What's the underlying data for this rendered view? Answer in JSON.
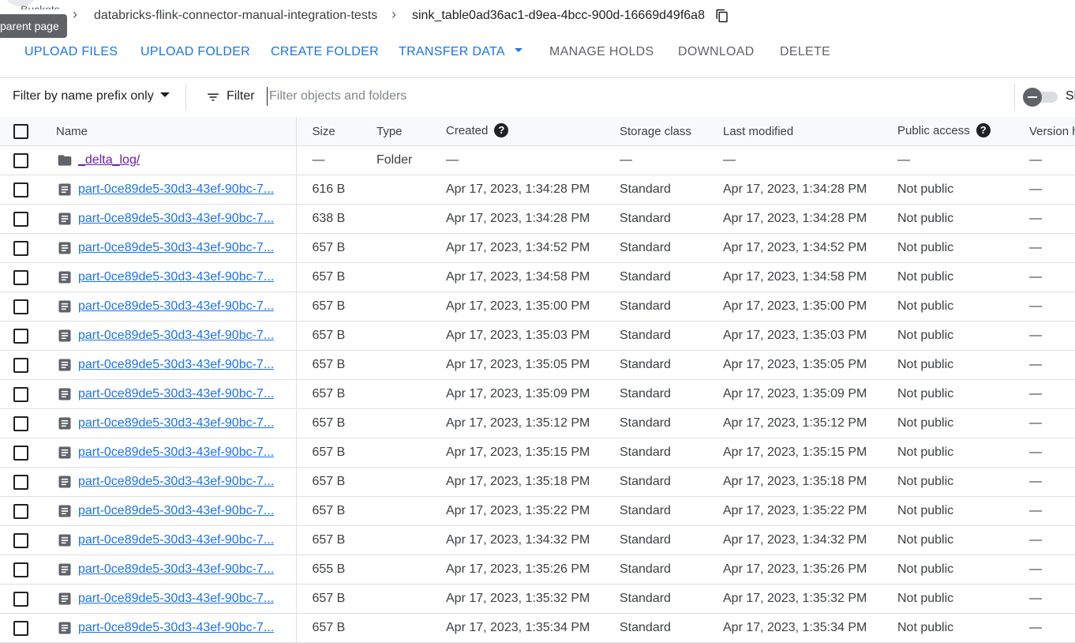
{
  "breadcrumb": {
    "root": "Buckets",
    "bucket": "databricks-flink-connector-manual-integration-tests",
    "folder": "sink_table0ad36ac1-d9ea-4bcc-900d-16669d49f6a8"
  },
  "tooltip": "parent page",
  "toolbar": {
    "upload_files": "UPLOAD FILES",
    "upload_folder": "UPLOAD FOLDER",
    "create_folder": "CREATE FOLDER",
    "transfer_data": "TRANSFER DATA",
    "manage_holds": "MANAGE HOLDS",
    "download": "DOWNLOAD",
    "delete": "DELETE"
  },
  "filter": {
    "prefix_mode": "Filter by name prefix only",
    "label": "Filter",
    "placeholder": "Filter objects and folders",
    "toggle_label": "Sh"
  },
  "columns": {
    "name": "Name",
    "size": "Size",
    "type": "Type",
    "created": "Created",
    "storage_class": "Storage class",
    "last_modified": "Last modified",
    "public_access": "Public access",
    "version_history": "Version h"
  },
  "rows": [
    {
      "kind": "folder",
      "name": "_delta_log/",
      "size": "—",
      "type": "Folder",
      "created": "—",
      "storage": "—",
      "modified": "—",
      "public": "—",
      "version": "—"
    },
    {
      "kind": "file",
      "name": "part-0ce89de5-30d3-43ef-90bc-7...",
      "size": "616 B",
      "type": "",
      "created": "Apr 17, 2023, 1:34:28 PM",
      "storage": "Standard",
      "modified": "Apr 17, 2023, 1:34:28 PM",
      "public": "Not public",
      "version": "—"
    },
    {
      "kind": "file",
      "name": "part-0ce89de5-30d3-43ef-90bc-7...",
      "size": "638 B",
      "type": "",
      "created": "Apr 17, 2023, 1:34:28 PM",
      "storage": "Standard",
      "modified": "Apr 17, 2023, 1:34:28 PM",
      "public": "Not public",
      "version": "—"
    },
    {
      "kind": "file",
      "name": "part-0ce89de5-30d3-43ef-90bc-7...",
      "size": "657 B",
      "type": "",
      "created": "Apr 17, 2023, 1:34:52 PM",
      "storage": "Standard",
      "modified": "Apr 17, 2023, 1:34:52 PM",
      "public": "Not public",
      "version": "—"
    },
    {
      "kind": "file",
      "name": "part-0ce89de5-30d3-43ef-90bc-7...",
      "size": "657 B",
      "type": "",
      "created": "Apr 17, 2023, 1:34:58 PM",
      "storage": "Standard",
      "modified": "Apr 17, 2023, 1:34:58 PM",
      "public": "Not public",
      "version": "—"
    },
    {
      "kind": "file",
      "name": "part-0ce89de5-30d3-43ef-90bc-7...",
      "size": "657 B",
      "type": "",
      "created": "Apr 17, 2023, 1:35:00 PM",
      "storage": "Standard",
      "modified": "Apr 17, 2023, 1:35:00 PM",
      "public": "Not public",
      "version": "—"
    },
    {
      "kind": "file",
      "name": "part-0ce89de5-30d3-43ef-90bc-7...",
      "size": "657 B",
      "type": "",
      "created": "Apr 17, 2023, 1:35:03 PM",
      "storage": "Standard",
      "modified": "Apr 17, 2023, 1:35:03 PM",
      "public": "Not public",
      "version": "—"
    },
    {
      "kind": "file",
      "name": "part-0ce89de5-30d3-43ef-90bc-7...",
      "size": "657 B",
      "type": "",
      "created": "Apr 17, 2023, 1:35:05 PM",
      "storage": "Standard",
      "modified": "Apr 17, 2023, 1:35:05 PM",
      "public": "Not public",
      "version": "—"
    },
    {
      "kind": "file",
      "name": "part-0ce89de5-30d3-43ef-90bc-7...",
      "size": "657 B",
      "type": "",
      "created": "Apr 17, 2023, 1:35:09 PM",
      "storage": "Standard",
      "modified": "Apr 17, 2023, 1:35:09 PM",
      "public": "Not public",
      "version": "—"
    },
    {
      "kind": "file",
      "name": "part-0ce89de5-30d3-43ef-90bc-7...",
      "size": "657 B",
      "type": "",
      "created": "Apr 17, 2023, 1:35:12 PM",
      "storage": "Standard",
      "modified": "Apr 17, 2023, 1:35:12 PM",
      "public": "Not public",
      "version": "—"
    },
    {
      "kind": "file",
      "name": "part-0ce89de5-30d3-43ef-90bc-7...",
      "size": "657 B",
      "type": "",
      "created": "Apr 17, 2023, 1:35:15 PM",
      "storage": "Standard",
      "modified": "Apr 17, 2023, 1:35:15 PM",
      "public": "Not public",
      "version": "—"
    },
    {
      "kind": "file",
      "name": "part-0ce89de5-30d3-43ef-90bc-7...",
      "size": "657 B",
      "type": "",
      "created": "Apr 17, 2023, 1:35:18 PM",
      "storage": "Standard",
      "modified": "Apr 17, 2023, 1:35:18 PM",
      "public": "Not public",
      "version": "—"
    },
    {
      "kind": "file",
      "name": "part-0ce89de5-30d3-43ef-90bc-7...",
      "size": "657 B",
      "type": "",
      "created": "Apr 17, 2023, 1:35:22 PM",
      "storage": "Standard",
      "modified": "Apr 17, 2023, 1:35:22 PM",
      "public": "Not public",
      "version": "—"
    },
    {
      "kind": "file",
      "name": "part-0ce89de5-30d3-43ef-90bc-7...",
      "size": "657 B",
      "type": "",
      "created": "Apr 17, 2023, 1:34:32 PM",
      "storage": "Standard",
      "modified": "Apr 17, 2023, 1:34:32 PM",
      "public": "Not public",
      "version": "—"
    },
    {
      "kind": "file",
      "name": "part-0ce89de5-30d3-43ef-90bc-7...",
      "size": "655 B",
      "type": "",
      "created": "Apr 17, 2023, 1:35:26 PM",
      "storage": "Standard",
      "modified": "Apr 17, 2023, 1:35:26 PM",
      "public": "Not public",
      "version": "—"
    },
    {
      "kind": "file",
      "name": "part-0ce89de5-30d3-43ef-90bc-7...",
      "size": "657 B",
      "type": "",
      "created": "Apr 17, 2023, 1:35:32 PM",
      "storage": "Standard",
      "modified": "Apr 17, 2023, 1:35:32 PM",
      "public": "Not public",
      "version": "—"
    },
    {
      "kind": "file",
      "name": "part-0ce89de5-30d3-43ef-90bc-7...",
      "size": "657 B",
      "type": "",
      "created": "Apr 17, 2023, 1:35:34 PM",
      "storage": "Standard",
      "modified": "Apr 17, 2023, 1:35:34 PM",
      "public": "Not public",
      "version": "—"
    }
  ],
  "icons": {
    "folder": "folder-icon",
    "file": "file-icon",
    "copy": "copy-icon",
    "filter": "filter-icon",
    "help": "help-icon"
  },
  "colors": {
    "accent": "#1a73e8",
    "visited_link": "#681da8",
    "header_bg": "#f8f9fa",
    "border": "#dadce0"
  }
}
